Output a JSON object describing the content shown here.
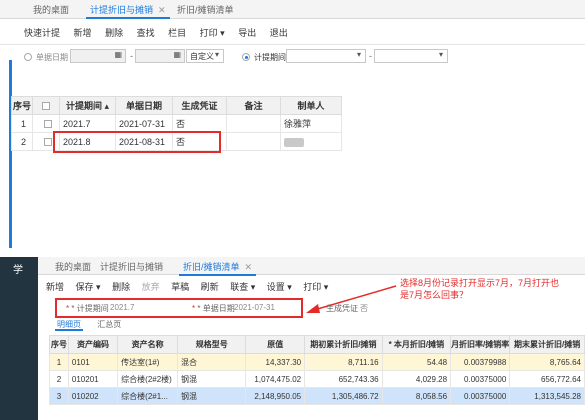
{
  "top": {
    "tabs": [
      {
        "label": "我的桌面",
        "active": false
      },
      {
        "label": "计提折旧与摊销",
        "active": true,
        "close": "✕"
      },
      {
        "label": "折旧/摊销清单",
        "active": false
      }
    ],
    "toolbar": [
      "快速计提",
      "新增",
      "删除",
      "查找",
      "栏目",
      "打印 ▾",
      "导出",
      "退出"
    ],
    "filter": {
      "doc_date_label": "单据日期",
      "period_label": "计提期间",
      "custom_label": "自定义",
      "dash": "-"
    },
    "table": {
      "headers": [
        "序号",
        "",
        "计提期间 ▴",
        "单据日期",
        "生成凭证",
        "备注",
        "制单人"
      ],
      "rows": [
        {
          "no": "1",
          "period": "2021.7",
          "date": "2021-07-31",
          "voucher": "否",
          "note": "",
          "maker": "徐雅萍"
        },
        {
          "no": "2",
          "period": "2021.8",
          "date": "2021-08-31",
          "voucher": "否",
          "note": "",
          "maker": ""
        }
      ]
    }
  },
  "bottom": {
    "tabs": [
      {
        "label": "我的桌面",
        "active": false
      },
      {
        "label": "计提折旧与摊销",
        "active": false
      },
      {
        "label": "折旧/摊销清单",
        "active": true,
        "close": "✕"
      }
    ],
    "toolbar": [
      "新增",
      "保存 ▾",
      "删除",
      "放弃",
      "草稿",
      "刷新",
      "联查 ▾",
      "设置 ▾",
      "打印 ▾"
    ],
    "fields": {
      "period_label": "* 计提期间",
      "period_value": "2021.7",
      "date_label": "* 单据日期",
      "date_value": "2021-07-31",
      "voucher_label": "生成凭证",
      "voucher_value": "否"
    },
    "subtabs": [
      "明细页",
      "汇总页"
    ],
    "table": {
      "headers": [
        "序号",
        "资产编码",
        "资产名称",
        "规格型号",
        "原值",
        "期初累计折旧/摊销",
        "* 本月折旧/摊销",
        "月折旧率/摊销率",
        "期末累计折旧/摊销"
      ],
      "rows": [
        {
          "no": "1",
          "code": "0101",
          "name": "传达室(1#)",
          "spec": "混合",
          "orig": "14,337.30",
          "open": "8,711.16",
          "month": "54.48",
          "rate": "0.00379988",
          "close": "8,765.64"
        },
        {
          "no": "2",
          "code": "010201",
          "name": "综合楼(2#2楼)",
          "spec": "钢混",
          "orig": "1,074,475.02",
          "open": "652,743.36",
          "month": "4,029.28",
          "rate": "0.00375000",
          "close": "656,772.64"
        },
        {
          "no": "3",
          "code": "010202",
          "name": "综合楼(2#1...",
          "spec": "钢混",
          "orig": "2,148,950.05",
          "open": "1,305,486.72",
          "month": "8,058.56",
          "rate": "0.00375000",
          "close": "1,313,545.28"
        }
      ]
    }
  },
  "annotation": "选择8月份记录打开显示7月，7月打开也是7月怎么回事？",
  "colors": {
    "accent": "#1f7bd8",
    "highlight": "#e52a2a"
  }
}
